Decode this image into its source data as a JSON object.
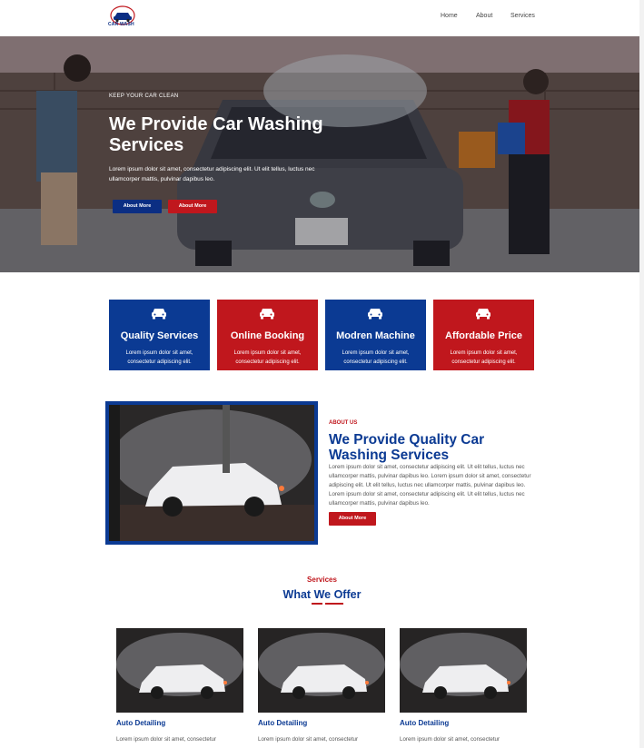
{
  "header": {
    "logo_text": "CAR WASH",
    "nav": [
      "Home",
      "About",
      "Services"
    ]
  },
  "hero": {
    "kicker": "KEEP YOUR CAR CLEAN",
    "title": "We Provide Car Washing Services",
    "description": "Lorem ipsum dolor sit amet, consectetur adipiscing elit. Ut elit tellus, luctus nec ullamcorper mattis, pulvinar dapibus leo.",
    "buttons": [
      "About More",
      "About More"
    ]
  },
  "features": [
    {
      "title": "Quality Services",
      "desc": "Lorem ipsum dolor sit amet, consectetur adipiscing elit.",
      "color": "#0b3a93"
    },
    {
      "title": "Online Booking",
      "desc": "Lorem ipsum dolor sit amet, consectetur adipiscing elit.",
      "color": "#c0171d"
    },
    {
      "title": "Modren Machine",
      "desc": "Lorem ipsum dolor sit amet, consectetur adipiscing elit.",
      "color": "#0b3a93"
    },
    {
      "title": "Affordable Price",
      "desc": "Lorem ipsum dolor sit amet, consectetur adipiscing elit.",
      "color": "#c0171d"
    }
  ],
  "about": {
    "kicker": "ABOUT US",
    "title": "We Provide Quality Car Washing Services",
    "text": "Lorem ipsum dolor sit amet, consectetur adipiscing elit. Ut elit tellus, luctus nec ullamcorper mattis, pulvinar dapibus leo. Lorem ipsum dolor sit amet, consectetur adipiscing elit. Ut elit tellus, luctus nec ullamcorper mattis, pulvinar dapibus leo. Lorem ipsum dolor sit amet, consectetur adipiscing elit. Ut elit tellus, luctus nec ullamcorper mattis, pulvinar dapibus leo.",
    "button": "About More"
  },
  "services": {
    "kicker": "Services",
    "title": "What We Offer",
    "cards": [
      {
        "title": "Auto Detailing",
        "text": "Lorem ipsum dolor sit amet, consectetur"
      },
      {
        "title": "Auto Detailing",
        "text": "Lorem ipsum dolor sit amet, consectetur"
      },
      {
        "title": "Auto Detailing",
        "text": "Lorem ipsum dolor sit amet, consectetur"
      }
    ]
  },
  "colors": {
    "primary": "#0b3a93",
    "accent": "#c0171d"
  },
  "icons": {
    "feature": "car-icon"
  }
}
